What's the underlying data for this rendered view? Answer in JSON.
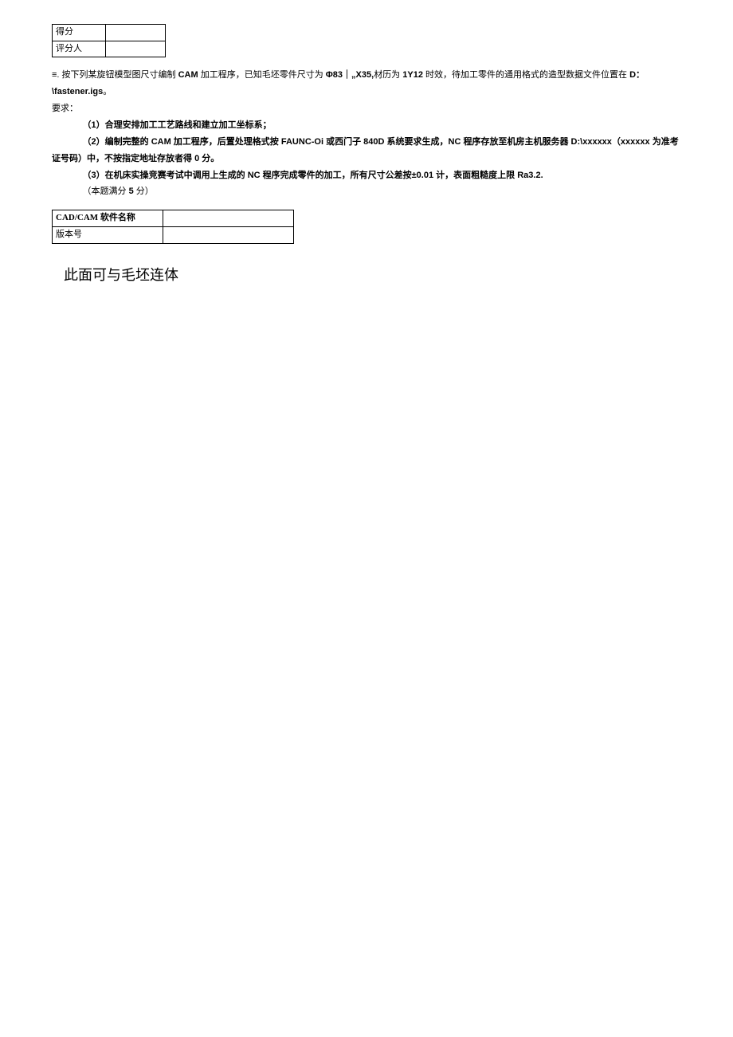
{
  "scoreTable": {
    "row1Label": "得分",
    "row1Value": "",
    "row2Label": "评分人",
    "row2Value": ""
  },
  "question": {
    "prefix": "≡. 按下列某旋钮模型图尺寸编制 ",
    "cam": "CAM",
    "part1a": " 加工程序，已知毛坯零件尺寸为 ",
    "phi": "Φ83｜„X35,",
    "part1b": "材历为 ",
    "material": "1Y12",
    "part1c": " 时效，待加工零件的通用格式的造型数据文件位置在 ",
    "drive": "D：",
    "filename": "\\fastener.igs",
    "period": "。"
  },
  "requirements": {
    "header": "要求：",
    "item1": "（1）合理安排加工工艺路线和建立加工坐标系；",
    "item2a": "（2）编制完整的 ",
    "item2cam": "CAM",
    "item2b": " 加工程序，后置处理格式按 ",
    "item2faunc": "FAUNC-Oi",
    "item2c": " 或西门子 ",
    "item2siemens": "840D",
    "item2d": " 系统要求生成，",
    "item2nc": "NC",
    "item2e": " 程序存放至机房主机服务器 ",
    "item2path": "D:\\xxxxxx",
    "item2f": "（",
    "item2code": "xxxxxx",
    "item2g": " 为准考证号码）中，不按指定地址存放者得 ",
    "item2zero": "0",
    "item2h": " 分。",
    "item3a": "（3）在机床实操竞赛考试中调用上生成的 ",
    "item3nc": "NC",
    "item3b": " 程序完成零件的加工，所有尺寸公差按",
    "item3tol": "±0.01",
    "item3c": " 计，表面粗糙度上限 ",
    "item3ra": "Ra3.2.",
    "scoreNote1": "（本题满分 ",
    "scoreNote2": "5",
    "scoreNote3": " 分）"
  },
  "softwareTable": {
    "row1Label": "CAD/CAM 软件名称",
    "row1Value": "",
    "row2Label": "版本号",
    "row2Value": ""
  },
  "annotation": "此面可与毛坯连体"
}
